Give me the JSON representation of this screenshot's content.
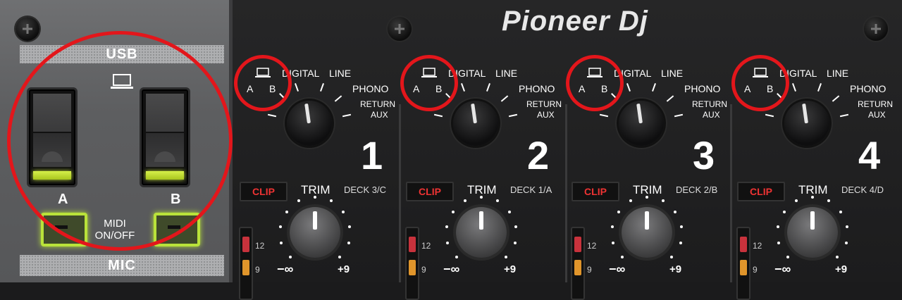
{
  "brand": {
    "logo_text": "Pioneer Dj"
  },
  "left_panel": {
    "usb_label": "USB",
    "switch_a_label": "A",
    "switch_b_label": "B",
    "midi_label_line1": "MIDI",
    "midi_label_line2": "ON/OFF",
    "mic_label": "MIC"
  },
  "channels": [
    {
      "number": "1",
      "deck": "DECK 3/C"
    },
    {
      "number": "2",
      "deck": "DECK 1/A"
    },
    {
      "number": "3",
      "deck": "DECK 2/B"
    },
    {
      "number": "4",
      "deck": "DECK 4/D"
    }
  ],
  "input_selector": {
    "a": "A",
    "b": "B",
    "digital": "DIGITAL",
    "line": "LINE",
    "phono": "PHONO",
    "return1": "RETURN",
    "return2": "AUX"
  },
  "trim": {
    "label": "TRIM",
    "clip": "CLIP",
    "min": "−∞",
    "max": "+9"
  },
  "meter": {
    "top": "12",
    "bottom": "9"
  },
  "colors": {
    "highlight_circle": "#e3161b",
    "led_green": "#c6e33a",
    "clip_red": "#e33333"
  },
  "icons": {
    "laptop": "laptop-icon",
    "screw": "screw-icon"
  }
}
